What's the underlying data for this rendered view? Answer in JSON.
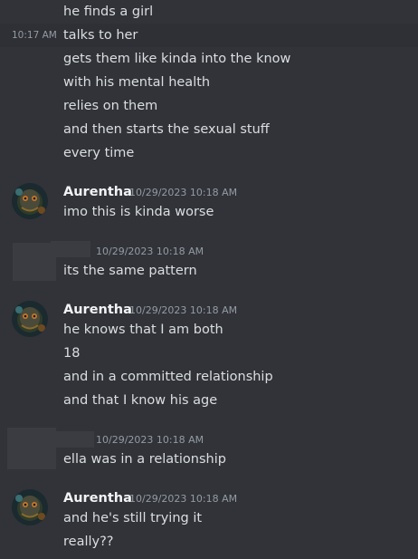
{
  "colors": {
    "background": "#313338",
    "hover_row": "#2e3035",
    "text": "#dbdee1",
    "username": "#f2f3f5",
    "timestamp": "#949ba4",
    "redaction": "#3a3c42"
  },
  "top_block": {
    "hover_timestamp": "10:17 AM",
    "lines": [
      "he finds a girl",
      "talks to her",
      "gets them like kinda into the know",
      "with his mental health",
      "relies on them",
      "and then starts the sexual stuff",
      "every time"
    ]
  },
  "messages": [
    {
      "author": "Aurentha",
      "timestamp": "10/29/2023 10:18 AM",
      "avatar_icon": "aurentha-avatar-icon",
      "lines": [
        "imo this is kinda worse"
      ]
    },
    {
      "author": "",
      "author_redacted": true,
      "timestamp": "10/29/2023 10:18 AM",
      "lines": [
        "its the same pattern"
      ]
    },
    {
      "author": "Aurentha",
      "timestamp": "10/29/2023 10:18 AM",
      "avatar_icon": "aurentha-avatar-icon",
      "lines": [
        "he knows that I am both",
        "18",
        "and in a committed relationship",
        "and that I know his age"
      ]
    },
    {
      "author": "",
      "author_redacted": true,
      "timestamp": "10/29/2023 10:18 AM",
      "lines": [
        "ella was in a relationship"
      ]
    },
    {
      "author": "Aurentha",
      "timestamp": "10/29/2023 10:18 AM",
      "avatar_icon": "aurentha-avatar-icon",
      "lines": [
        "and he's still trying it",
        "really??"
      ]
    }
  ]
}
